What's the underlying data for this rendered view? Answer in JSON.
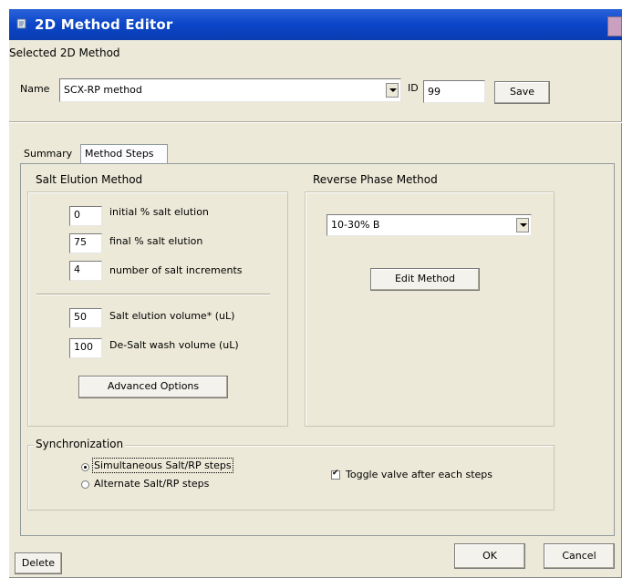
{
  "window": {
    "title": "2D Method Editor"
  },
  "selected_method": {
    "group_label": "Selected 2D Method",
    "name_label": "Name",
    "name_value": "SCX-RP method",
    "id_label": "ID",
    "id_value": "99",
    "save_label": "Save"
  },
  "tabs": [
    {
      "label": "Summary",
      "active": false
    },
    {
      "label": "Method Steps",
      "active": true
    }
  ],
  "salt_elution": {
    "group_label": "Salt Elution Method",
    "rows": [
      {
        "value": "0",
        "label": "initial % salt elution"
      },
      {
        "value": "75",
        "label": "final % salt elution"
      },
      {
        "value": "4",
        "label": "number of salt increments"
      },
      {
        "value": "50",
        "label": "Salt elution volume* (uL)"
      },
      {
        "value": "100",
        "label": "De-Salt wash volume (uL)"
      }
    ],
    "advanced_label": "Advanced Options"
  },
  "reverse_phase": {
    "group_label": "Reverse Phase Method",
    "selected_method": "10-30% B",
    "edit_label": "Edit Method"
  },
  "synchronization": {
    "group_label": "Synchronization",
    "options": [
      {
        "label": "Simultaneous Salt/RP steps",
        "selected": true
      },
      {
        "label": "Alternate Salt/RP steps",
        "selected": false
      }
    ],
    "toggle_label": "Toggle valve after each steps",
    "toggle_checked": true
  },
  "footer": {
    "delete_label": "Delete",
    "ok_label": "OK",
    "cancel_label": "Cancel"
  },
  "colors": {
    "titlebar": "#0b45c8",
    "dialog_bg": "#ece9d8"
  }
}
